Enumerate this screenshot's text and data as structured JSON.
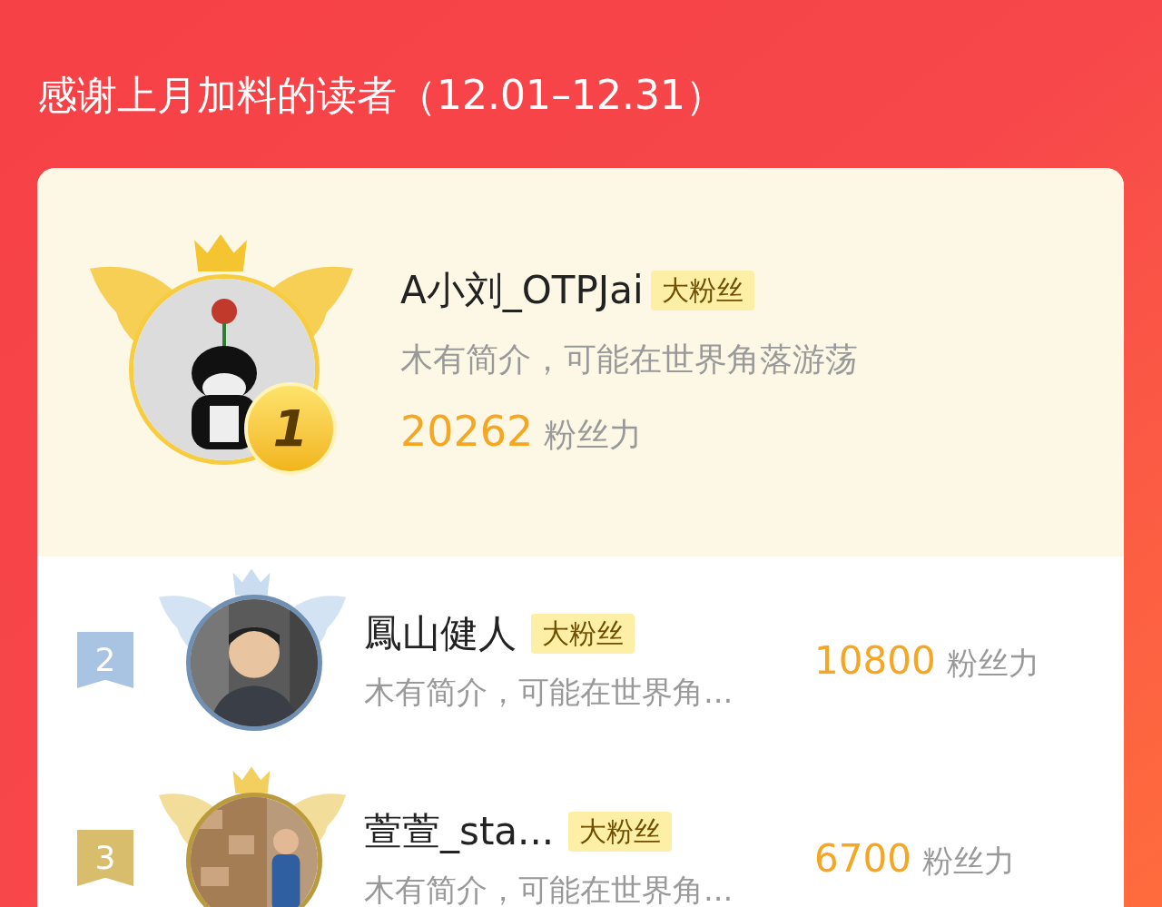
{
  "title": "感谢上月加料的读者（12.01–12.31）",
  "top": {
    "rank": "1",
    "name": "A小刘_OTPJai",
    "badge": "大粉丝",
    "bio": "木有简介，可能在世界角落游荡",
    "score": "20262",
    "score_unit": "粉丝力"
  },
  "rows": [
    {
      "rank": "2",
      "color": "#a9c4e2",
      "name": "鳳山健人",
      "badge": "大粉丝",
      "bio": "木有简介，可能在世界角...",
      "score": "10800",
      "score_unit": "粉丝力"
    },
    {
      "rank": "3",
      "color": "#d8bd6c",
      "name": "萱萱_sta...",
      "badge": "大粉丝",
      "bio": "木有简介，可能在世界角...",
      "score": "6700",
      "score_unit": "粉丝力"
    }
  ]
}
